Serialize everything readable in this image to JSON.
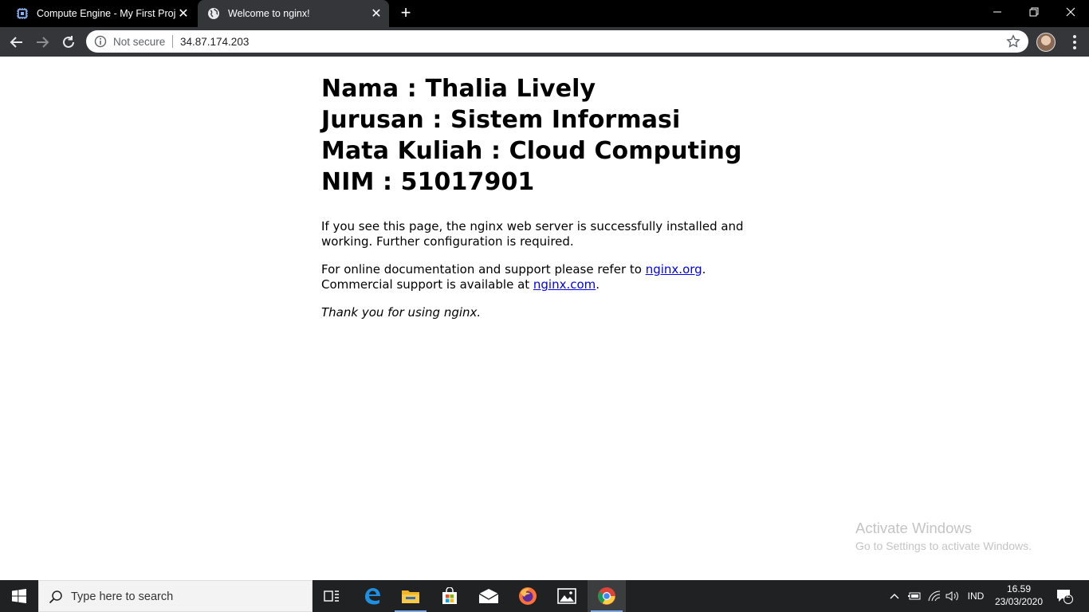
{
  "browser": {
    "tabs": [
      {
        "title": "Compute Engine - My First Proje",
        "active": false
      },
      {
        "title": "Welcome to nginx!",
        "active": true
      }
    ],
    "security_label": "Not secure",
    "url": "34.87.174.203"
  },
  "page": {
    "headings": [
      "Nama : Thalia Lively",
      "Jurusan : Sistem Informasi",
      "Mata Kuliah : Cloud Computing",
      "NIM : 51017901"
    ],
    "para1": "If you see this page, the nginx web server is successfully installed and working. Further configuration is required.",
    "para2_prefix": "For online documentation and support please refer to ",
    "link_org": "nginx.org",
    "para2_mid": ".",
    "para2_line2": "Commercial support is available at ",
    "link_com": "nginx.com",
    "para2_end": ".",
    "thanks": "Thank you for using nginx."
  },
  "watermark": {
    "title": "Activate Windows",
    "subtitle": "Go to Settings to activate Windows."
  },
  "taskbar": {
    "search_placeholder": "Type here to search",
    "language": "IND",
    "time": "16.59",
    "date": "23/03/2020",
    "notification_count": "2",
    "apps": [
      "task-view",
      "edge",
      "file-explorer",
      "store",
      "mail",
      "firefox",
      "photos",
      "chrome"
    ]
  },
  "colors": {
    "tab_bar": "#000000",
    "toolbar": "#35363a",
    "link": "#0000ee",
    "taskbar": "#1f2122"
  }
}
